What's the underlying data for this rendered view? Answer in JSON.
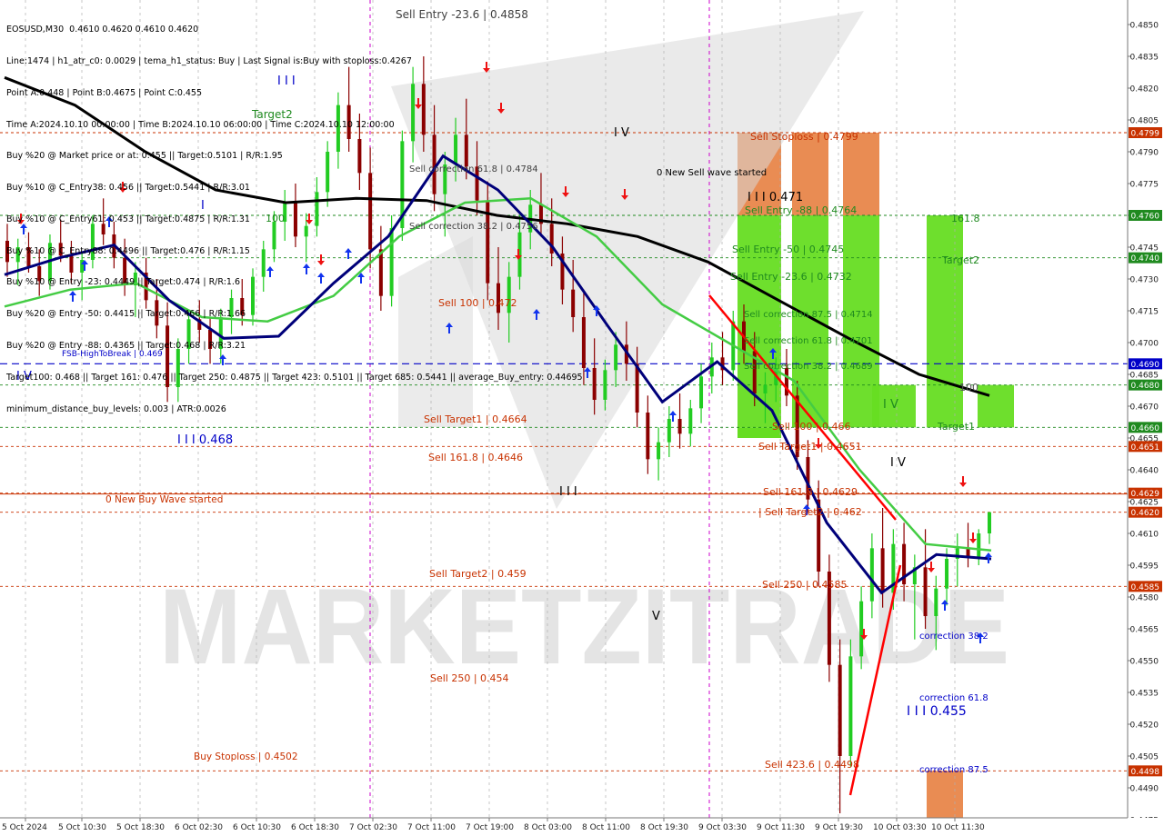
{
  "chart_data": {
    "type": "candlestick",
    "symbol_title": "EOSUSD,M30",
    "y_range": [
      0.447,
      0.4865
    ],
    "price_ticks": [
      "0.4850",
      "0.4835",
      "0.4820",
      "0.4805",
      "0.4790",
      "0.4775",
      "0.4760",
      "0.4745",
      "0.4730",
      "0.4715",
      "0.4700",
      "0.4685",
      "0.4670",
      "0.4655",
      "0.4640",
      "0.4625",
      "0.4610",
      "0.4595",
      "0.4580",
      "0.4565",
      "0.4550",
      "0.4535",
      "0.4520",
      "0.4505",
      "0.4490",
      "0.4475"
    ],
    "time_ticks": [
      "5 Oct 2024",
      "5 Oct 10:30",
      "5 Oct 18:30",
      "6 Oct 02:30",
      "6 Oct 10:30",
      "6 Oct 18:30",
      "7 Oct 02:30",
      "7 Oct 11:00",
      "7 Oct 19:00",
      "8 Oct 03:00",
      "8 Oct 11:00",
      "8 Oct 19:30",
      "9 Oct 03:30",
      "9 Oct 11:30",
      "9 Oct 19:30",
      "10 Oct 03:30",
      "10 Oct 11:30"
    ],
    "info_lines": [
      "EOSUSD,M30  0.4610 0.4620 0.4610 0.4620",
      "Line:1474 | h1_atr_c0: 0.0029 | tema_h1_status: Buy | Last Signal is:Buy with stoploss:0.4267",
      "Point A:0.448 | Point B:0.4675 | Point C:0.455",
      "Time A:2024.10.10 00:00:00 | Time B:2024.10.10 06:00:00 | Time C:2024.10.10 12:00:00",
      "Buy %20 @ Market price or at: 0.455 || Target:0.5101 | R/R:1.95",
      "Buy %10 @ C_Entry38: 0.456 || Target:0.5441 | R/R:3.01",
      "Buy %10 @ C_Entry61: 0.453 || Target:0.4875 | R/R:1.31",
      "Buy %10 @ C_Entry88: 0.4496 || Target:0.476 | R/R:1.15",
      "Buy %10 @ Entry -23: 0.4449 || Target:0.474 | R/R:1.6",
      "Buy %20 @ Entry -50: 0.4415 || Target:0.466 | R/R:1.66",
      "Buy %20 @ Entry -88: 0.4365 || Target:0.468 | R/R:3.21",
      "Target100: 0.468 || Target 161: 0.476 || Target 250: 0.4875 || Target 423: 0.5101 || Target 685: 0.5441 || average_Buy_entry: 0.44695",
      "minimum_distance_buy_levels: 0.003 | ATR:0.0026"
    ],
    "levels": [
      {
        "label": "Sell Stoploss | 0.4799",
        "price": 0.4799,
        "color": "#c83200",
        "badge": "0.4799"
      },
      {
        "label": "Sell Entry -88 | 0.4764",
        "price": 0.476,
        "color": "#1f8a1f",
        "badge": "0.4760"
      },
      {
        "label": "Sell Entry -50 | 0.4745",
        "price": 0.474,
        "color": "#1f8a1f",
        "badge": "0.4740"
      },
      {
        "label": "FSB-HighToBreak | 0.469",
        "price": 0.469,
        "color": "#0000c8",
        "badge": "0.4690"
      },
      {
        "label": "",
        "price": 0.468,
        "color": "#1f8a1f",
        "badge": "0.4680"
      },
      {
        "label": "",
        "price": 0.466,
        "color": "#1f8a1f",
        "badge": "0.4660"
      },
      {
        "label": "",
        "price": 0.4651,
        "color": "#c83200",
        "badge": "0.4651"
      },
      {
        "label": "",
        "price": 0.4629,
        "color": "#c83200",
        "badge": "0.4629"
      },
      {
        "label": "0 New Buy Wave started",
        "price": 0.462,
        "color": "#c83200",
        "badge": "0.4620"
      },
      {
        "label": "",
        "price": 0.4585,
        "color": "#c83200",
        "badge": "0.4585"
      },
      {
        "label": "Buy Stoploss | 0.4502",
        "price": 0.4498,
        "color": "#c83200",
        "badge": "0.4498"
      }
    ],
    "annotations": [
      {
        "text": "Sell Entry -23.6 | 0.4858",
        "color": "#404040"
      },
      {
        "text": "Target2",
        "color": "#1f8a1f"
      },
      {
        "text": "I I I",
        "color": "#0000c8"
      },
      {
        "text": "I V",
        "color": "#000000"
      },
      {
        "text": "Sell correction 61.8 | 0.4784",
        "color": "#404040"
      },
      {
        "text": "Sell correction 38.2 | 0.4756",
        "color": "#404040"
      },
      {
        "text": "Sell 100 | 0.472",
        "color": "#c83200"
      },
      {
        "text": "Sell Target1 | 0.4664",
        "color": "#c83200"
      },
      {
        "text": "Sell 161.8 | 0.4646",
        "color": "#c83200"
      },
      {
        "text": "I I I 0.468",
        "color": "#0000c8"
      },
      {
        "text": "Sell Target2 | 0.459",
        "color": "#c83200"
      },
      {
        "text": "Sell  250 | 0.454",
        "color": "#c83200"
      },
      {
        "text": "0 New Sell wave started",
        "color": "#000000"
      },
      {
        "text": "I I I 0.471",
        "color": "#000000"
      },
      {
        "text": "Sell Stoploss | 0.4799",
        "color": "#c83200"
      },
      {
        "text": "Sell Entry -88 | 0.4764",
        "color": "#1f8a1f"
      },
      {
        "text": "Sell Entry -50 | 0.4745",
        "color": "#1f8a1f"
      },
      {
        "text": "Sell Entry -23.6 | 0.4732",
        "color": "#1f8a1f"
      },
      {
        "text": "Sell correction 87.5 | 0.4714",
        "color": "#1f8a1f"
      },
      {
        "text": "Sell correction 61.8 | 0.4701",
        "color": "#1f8a1f"
      },
      {
        "text": "Sell correction 38.2 | 0.4689",
        "color": "#1f8a1f"
      },
      {
        "text": "Sell 100 | 0.466",
        "color": "#c83200"
      },
      {
        "text": "Sell Target1 | 0.4651",
        "color": "#c83200"
      },
      {
        "text": "Sell 161.8 | 0.4629",
        "color": "#c83200"
      },
      {
        "text": "| Sell Target2 | 0.462",
        "color": "#c83200"
      },
      {
        "text": "Sell  250 | 0.4585",
        "color": "#c83200"
      },
      {
        "text": "Sell  423.6 | 0.4498",
        "color": "#c83200"
      },
      {
        "text": "161.8",
        "color": "#1f8a1f"
      },
      {
        "text": "Target2",
        "color": "#1f8a1f"
      },
      {
        "text": "Target1",
        "color": "#1f8a1f"
      },
      {
        "text": "100",
        "color": "#1f8a1f"
      },
      {
        "text": "I V",
        "color": "#1f8a1f"
      },
      {
        "text": "correction 38.2",
        "color": "#0000c8"
      },
      {
        "text": "correction 61.8",
        "color": "#0000c8"
      },
      {
        "text": "correction 87.5",
        "color": "#0000c8"
      },
      {
        "text": "I I I 0.455",
        "color": "#0000c8"
      },
      {
        "text": "V",
        "color": "#000000"
      },
      {
        "text": "I V",
        "color": "#0000c8"
      },
      {
        "text": "I I I",
        "color": "#000000"
      },
      {
        "text": "I V",
        "color": "#000000"
      },
      {
        "text": "I",
        "color": "#0000c8"
      }
    ],
    "zones": [
      {
        "name": "sell-stoploss-zone",
        "color": "#e8864a",
        "from": 0.476,
        "to": 0.4799
      },
      {
        "name": "sell-entry-zone",
        "color": "#66dd22",
        "from": 0.466,
        "to": 0.476
      },
      {
        "name": "buy-target-zone",
        "color": "#66dd22",
        "from": 0.4475,
        "to": 0.476
      },
      {
        "name": "buy-stop-zone",
        "color": "#e8864a",
        "from": 0.4475,
        "to": 0.4498
      }
    ],
    "candles_approx": [
      [
        0.4748,
        0.4756,
        0.4731,
        0.4738
      ],
      [
        0.4738,
        0.4749,
        0.4727,
        0.4745
      ],
      [
        0.4745,
        0.4752,
        0.4733,
        0.4736
      ],
      [
        0.4736,
        0.4744,
        0.4722,
        0.4729
      ],
      [
        0.4729,
        0.4751,
        0.4725,
        0.4747
      ],
      [
        0.4747,
        0.4758,
        0.4738,
        0.4741
      ],
      [
        0.4741,
        0.4748,
        0.4728,
        0.4733
      ],
      [
        0.4733,
        0.4742,
        0.472,
        0.4739
      ],
      [
        0.4739,
        0.476,
        0.4735,
        0.4756
      ],
      [
        0.4756,
        0.4768,
        0.4746,
        0.4751
      ],
      [
        0.4751,
        0.4757,
        0.4735,
        0.474
      ],
      [
        0.474,
        0.4749,
        0.4722,
        0.4727
      ],
      [
        0.4727,
        0.4738,
        0.4712,
        0.4733
      ],
      [
        0.4733,
        0.474,
        0.4716,
        0.472
      ],
      [
        0.472,
        0.473,
        0.4702,
        0.4708
      ],
      [
        0.4708,
        0.4719,
        0.4672,
        0.4679
      ],
      [
        0.4679,
        0.4702,
        0.4672,
        0.4697
      ],
      [
        0.4697,
        0.4715,
        0.469,
        0.4711
      ],
      [
        0.4711,
        0.472,
        0.47,
        0.4706
      ],
      [
        0.4706,
        0.4712,
        0.469,
        0.4697
      ],
      [
        0.4697,
        0.4716,
        0.469,
        0.4712
      ],
      [
        0.4712,
        0.4725,
        0.4704,
        0.4721
      ],
      [
        0.4721,
        0.473,
        0.4708,
        0.4713
      ],
      [
        0.4713,
        0.4735,
        0.4708,
        0.4731
      ],
      [
        0.4731,
        0.4748,
        0.4724,
        0.4744
      ],
      [
        0.4744,
        0.4762,
        0.4738,
        0.4757
      ],
      [
        0.4757,
        0.4772,
        0.4748,
        0.4766
      ],
      [
        0.4766,
        0.4775,
        0.4745,
        0.475
      ],
      [
        0.475,
        0.4761,
        0.4738,
        0.4755
      ],
      [
        0.4755,
        0.4778,
        0.475,
        0.4771
      ],
      [
        0.4771,
        0.4795,
        0.4764,
        0.479
      ],
      [
        0.479,
        0.4818,
        0.4782,
        0.4812
      ],
      [
        0.4812,
        0.483,
        0.479,
        0.4796
      ],
      [
        0.4796,
        0.4808,
        0.4772,
        0.478
      ],
      [
        0.478,
        0.4792,
        0.4735,
        0.4744
      ],
      [
        0.4744,
        0.4755,
        0.4715,
        0.4722
      ],
      [
        0.4722,
        0.476,
        0.4717,
        0.4754
      ],
      [
        0.4754,
        0.48,
        0.4748,
        0.4795
      ],
      [
        0.4795,
        0.483,
        0.4785,
        0.4822
      ],
      [
        0.4822,
        0.4835,
        0.479,
        0.4798
      ],
      [
        0.4798,
        0.4812,
        0.4762,
        0.477
      ],
      [
        0.477,
        0.479,
        0.475,
        0.4784
      ],
      [
        0.4784,
        0.4806,
        0.4776,
        0.4798
      ],
      [
        0.4798,
        0.4815,
        0.4777,
        0.4783
      ],
      [
        0.4783,
        0.4795,
        0.476,
        0.4767
      ],
      [
        0.4767,
        0.4776,
        0.472,
        0.4728
      ],
      [
        0.4728,
        0.4745,
        0.4706,
        0.4714
      ],
      [
        0.4714,
        0.4738,
        0.47,
        0.4731
      ],
      [
        0.4731,
        0.476,
        0.4725,
        0.4752
      ],
      [
        0.4752,
        0.4772,
        0.4744,
        0.4765
      ],
      [
        0.4765,
        0.478,
        0.475,
        0.4756
      ],
      [
        0.4756,
        0.4768,
        0.4736,
        0.4742
      ],
      [
        0.4742,
        0.475,
        0.4718,
        0.4725
      ],
      [
        0.4725,
        0.4739,
        0.4705,
        0.4712
      ],
      [
        0.4712,
        0.4725,
        0.468,
        0.4688
      ],
      [
        0.4688,
        0.4702,
        0.4666,
        0.4673
      ],
      [
        0.4673,
        0.4692,
        0.4668,
        0.4687
      ],
      [
        0.4687,
        0.4705,
        0.4679,
        0.4699
      ],
      [
        0.4699,
        0.471,
        0.4682,
        0.469
      ],
      [
        0.469,
        0.4698,
        0.466,
        0.4667
      ],
      [
        0.4667,
        0.4675,
        0.4638,
        0.4645
      ],
      [
        0.4645,
        0.466,
        0.4635,
        0.4653
      ],
      [
        0.4653,
        0.467,
        0.4646,
        0.4664
      ],
      [
        0.4664,
        0.4676,
        0.465,
        0.4657
      ],
      [
        0.4657,
        0.4673,
        0.4651,
        0.4669
      ],
      [
        0.4669,
        0.469,
        0.4662,
        0.4684
      ],
      [
        0.4684,
        0.47,
        0.4676,
        0.4693
      ],
      [
        0.4693,
        0.4705,
        0.468,
        0.4687
      ],
      [
        0.4687,
        0.4715,
        0.4682,
        0.471
      ],
      [
        0.471,
        0.4718,
        0.469,
        0.4696
      ],
      [
        0.4696,
        0.4705,
        0.467,
        0.4676
      ],
      [
        0.4676,
        0.4686,
        0.4662,
        0.468
      ],
      [
        0.468,
        0.4693,
        0.4672,
        0.4688
      ],
      [
        0.4688,
        0.4697,
        0.467,
        0.4675
      ],
      [
        0.4675,
        0.4682,
        0.464,
        0.4646
      ],
      [
        0.4646,
        0.4654,
        0.462,
        0.4626
      ],
      [
        0.4626,
        0.4635,
        0.4585,
        0.4592
      ],
      [
        0.4592,
        0.46,
        0.454,
        0.4548
      ],
      [
        0.4548,
        0.456,
        0.4478,
        0.4505
      ],
      [
        0.4505,
        0.456,
        0.45,
        0.4552
      ],
      [
        0.4552,
        0.4585,
        0.4546,
        0.4578
      ],
      [
        0.4578,
        0.461,
        0.457,
        0.4603
      ],
      [
        0.4603,
        0.4622,
        0.4575,
        0.4582
      ],
      [
        0.4582,
        0.4612,
        0.4574,
        0.4605
      ],
      [
        0.4605,
        0.4615,
        0.4578,
        0.4586
      ],
      [
        0.4586,
        0.46,
        0.456,
        0.4594
      ],
      [
        0.4594,
        0.4612,
        0.4565,
        0.4571
      ],
      [
        0.4571,
        0.459,
        0.4555,
        0.4584
      ],
      [
        0.4584,
        0.4603,
        0.4576,
        0.4598
      ],
      [
        0.4598,
        0.461,
        0.4585,
        0.4603
      ],
      [
        0.4603,
        0.4615,
        0.4594,
        0.4599
      ],
      [
        0.4599,
        0.4612,
        0.4595,
        0.461
      ],
      [
        0.461,
        0.462,
        0.4605,
        0.462
      ]
    ],
    "indicators": [
      {
        "name": "slow-ma",
        "color": "#000000",
        "points": [
          0.4825,
          0.4812,
          0.479,
          0.4772,
          0.4766,
          0.4768,
          0.4767,
          0.476,
          0.4756,
          0.475,
          0.4738,
          0.472,
          0.4702,
          0.4685,
          0.4675
        ]
      },
      {
        "name": "mid-ma",
        "color": "#44cc44",
        "points": [
          0.4717,
          0.4725,
          0.4728,
          0.4712,
          0.471,
          0.4722,
          0.475,
          0.4766,
          0.4768,
          0.475,
          0.4718,
          0.47,
          0.4682,
          0.464,
          0.4605,
          0.4602
        ]
      },
      {
        "name": "fast-ma",
        "color": "#00007a",
        "points": [
          0.4732,
          0.474,
          0.4746,
          0.472,
          0.4702,
          0.4703,
          0.4728,
          0.475,
          0.4788,
          0.4772,
          0.4745,
          0.4708,
          0.4672,
          0.4691,
          0.4668,
          0.4615,
          0.4582,
          0.46,
          0.4598
        ]
      }
    ],
    "watermark": "MARKETZITRADE"
  }
}
